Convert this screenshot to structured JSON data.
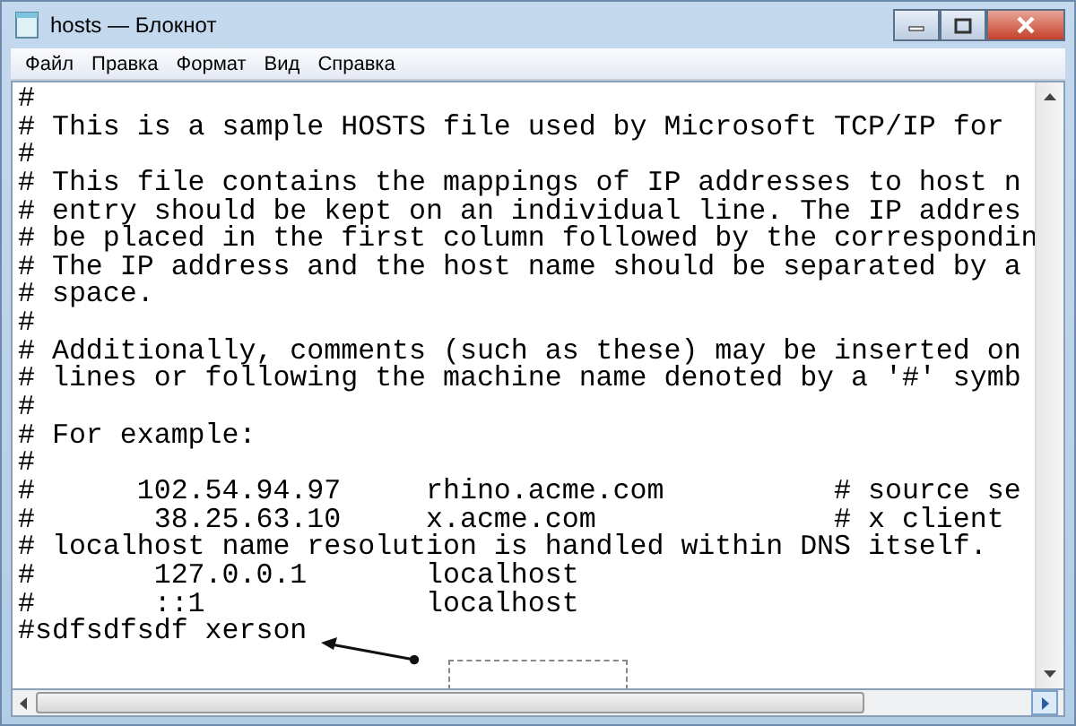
{
  "window": {
    "title": "hosts — Блокнот"
  },
  "menu": [
    "Файл",
    "Правка",
    "Формат",
    "Вид",
    "Справка"
  ],
  "lines": [
    "#",
    "# This is a sample HOSTS file used by Microsoft TCP/IP for",
    "#",
    "# This file contains the mappings of IP addresses to host n",
    "# entry should be kept on an individual line. The IP addres",
    "# be placed in the first column followed by the correspondin",
    "# The IP address and the host name should be separated by a",
    "# space.",
    "#",
    "# Additionally, comments (such as these) may be inserted on",
    "# lines or following the machine name denoted by a '#' symb",
    "#",
    "# For example:",
    "#",
    "#      102.54.94.97     rhino.acme.com          # source se",
    "#       38.25.63.10     x.acme.com              # x client",
    "# localhost name resolution is handled within DNS itself.",
    "#       127.0.0.1       localhost",
    "#       ::1             localhost",
    "#sdfsdfsdf xerson"
  ]
}
